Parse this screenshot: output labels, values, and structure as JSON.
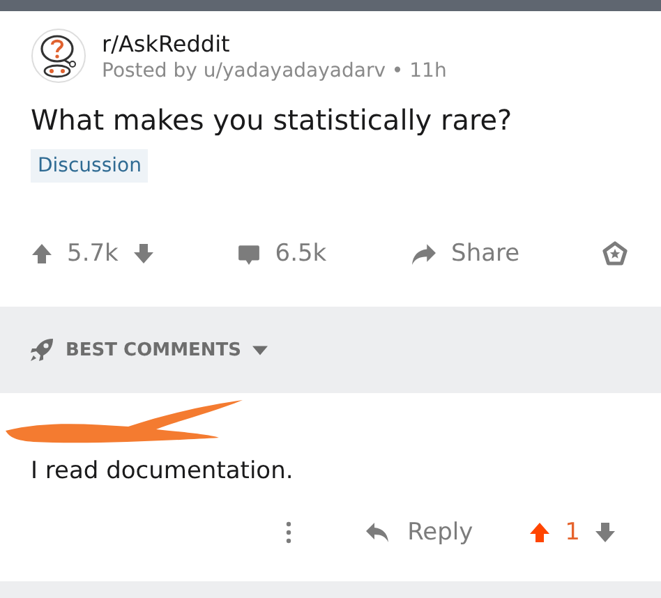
{
  "post": {
    "subreddit": "r/AskReddit",
    "byline": "Posted by u/yadayadayadarv • 11h",
    "title": "What makes you statistically rare?",
    "flair": "Discussion",
    "upvoted": false,
    "score": "5.7k",
    "comments": "6.5k",
    "share": "Share"
  },
  "sort": {
    "label": "BEST COMMENTS"
  },
  "comment": {
    "author_redacted": true,
    "body": "I read documentation.",
    "reply": "Reply",
    "upvoted": true,
    "score": "1"
  }
}
